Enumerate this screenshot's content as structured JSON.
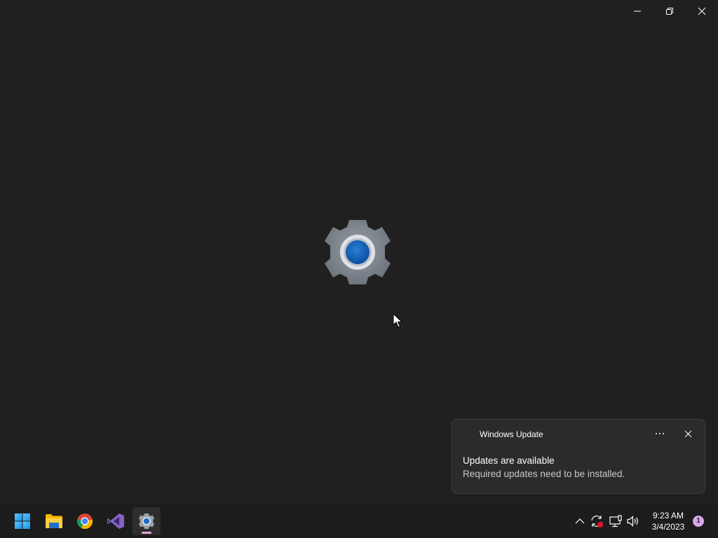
{
  "window": {
    "buttons": {
      "minimize": "minimize-icon",
      "maximize": "restore-icon",
      "close": "close-icon"
    },
    "splash_icon": "settings-gear-icon"
  },
  "toast": {
    "app_name": "Windows Update",
    "title": "Updates are available",
    "body": "Required updates need to be installed.",
    "more_icon": "more-options-icon",
    "close_icon": "close-icon"
  },
  "taskbar": {
    "apps": [
      {
        "name": "Start",
        "icon": "windows-start-icon"
      },
      {
        "name": "File Explorer",
        "icon": "folder-icon"
      },
      {
        "name": "Google Chrome",
        "icon": "chrome-icon"
      },
      {
        "name": "Visual Studio",
        "icon": "visual-studio-icon"
      },
      {
        "name": "Settings",
        "icon": "settings-gear-icon",
        "active": true
      }
    ],
    "tray": {
      "icons": [
        "chevron-up-icon",
        "update-sync-icon",
        "network-icon",
        "volume-icon"
      ],
      "time": "9:23 AM",
      "date": "3/4/2023",
      "notification_count": "1"
    }
  },
  "colors": {
    "background": "#202020",
    "taskbar": "#1c1c1c",
    "accent_blue": "#0f5fb8",
    "active_indicator": "#e8a6d8"
  }
}
